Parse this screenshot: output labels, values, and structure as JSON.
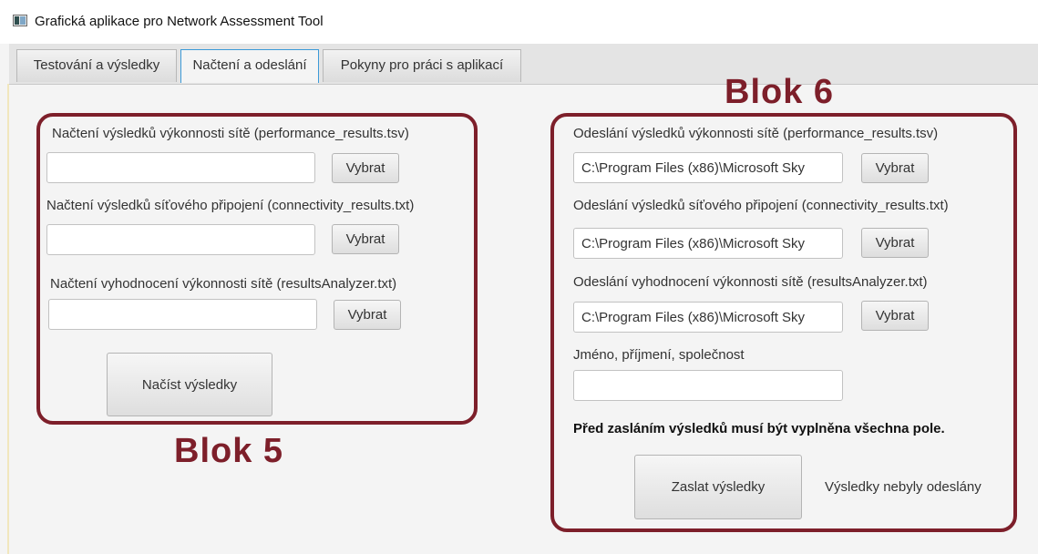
{
  "window": {
    "title": "Grafická aplikace pro Network Assessment Tool",
    "icon": "window-app-icon"
  },
  "tabs": [
    {
      "label": "Testování a výsledky",
      "active": false
    },
    {
      "label": "Načtení a odeslání",
      "active": true
    },
    {
      "label": "Pokyny pro práci s aplikací",
      "active": false
    }
  ],
  "colors": {
    "annotation": "#7d1f2a",
    "tab_focus": "#3c9ad8",
    "background": "#f4f4f4"
  },
  "block5": {
    "caption": "Blok 5",
    "performance": {
      "label": "Načtení výsledků výkonnosti sítě (performance_results.tsv)",
      "value": "",
      "button": "Vybrat"
    },
    "connectivity": {
      "label": "Načtení výsledků síťového připojení (connectivity_results.txt)",
      "value": "",
      "button": "Vybrat"
    },
    "analyzer": {
      "label": "Načtení vyhodnocení výkonnosti sítě (resultsAnalyzer.txt)",
      "value": "",
      "button": "Vybrat"
    },
    "load_button": "Načíst výsledky"
  },
  "block6": {
    "caption": "Blok 6",
    "performance": {
      "label": "Odeslání výsledků výkonnosti sítě (performance_results.tsv)",
      "value": "C:\\Program Files (x86)\\Microsoft Sky",
      "button": "Vybrat"
    },
    "connectivity": {
      "label": "Odeslání výsledků síťového připojení (connectivity_results.txt)",
      "value": "C:\\Program Files (x86)\\Microsoft Sky",
      "button": "Vybrat"
    },
    "analyzer": {
      "label": "Odeslání vyhodnocení výkonnosti sítě (resultsAnalyzer.txt)",
      "value": "C:\\Program Files (x86)\\Microsoft Sky",
      "button": "Vybrat"
    },
    "name": {
      "label": "Jméno, příjmení, společnost",
      "value": ""
    },
    "warning": "Před zasláním výsledků musí být vyplněna všechna pole.",
    "send_button": "Zaslat výsledky",
    "status": "Výsledky nebyly odeslány"
  }
}
